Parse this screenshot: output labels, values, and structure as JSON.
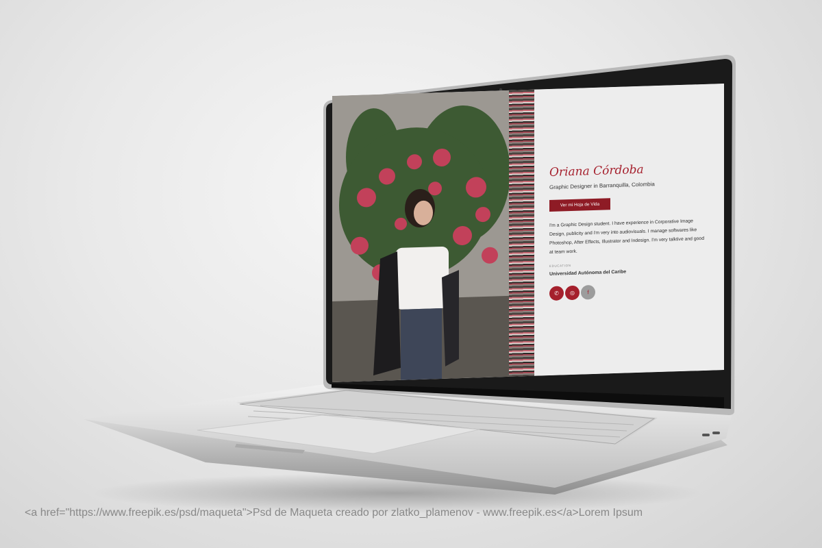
{
  "profile": {
    "name": "Oriana Córdoba",
    "role": "Graphic Designer in Barranquilla, Colombia",
    "cv_button": "Ver mi Hoja de Vida",
    "bio": "I'm a Graphic Design student. I have experience in Corporative Image Design, publicity and i'm very into audiovisuals. I manage softwares like Photoshop, After Effects, Illustrator and Indesign. I'm very talktive and good at team work.",
    "education_label": "EDUCATION",
    "education": "Universidad Autónoma del Caribe"
  },
  "social": [
    {
      "icon": "whatsapp-icon",
      "glyph": "✆"
    },
    {
      "icon": "instagram-icon",
      "glyph": "◎"
    },
    {
      "icon": "facebook-icon",
      "glyph": "f"
    }
  ],
  "colors": {
    "accent": "#a5202c",
    "button": "#8e1b25",
    "panel": "#ededed"
  },
  "footer_text": "<a href=\"https://www.freepik.es/psd/maqueta\">Psd de Maqueta creado por zlatko_plamenov - www.freepik.es</a>Lorem Ipsum"
}
